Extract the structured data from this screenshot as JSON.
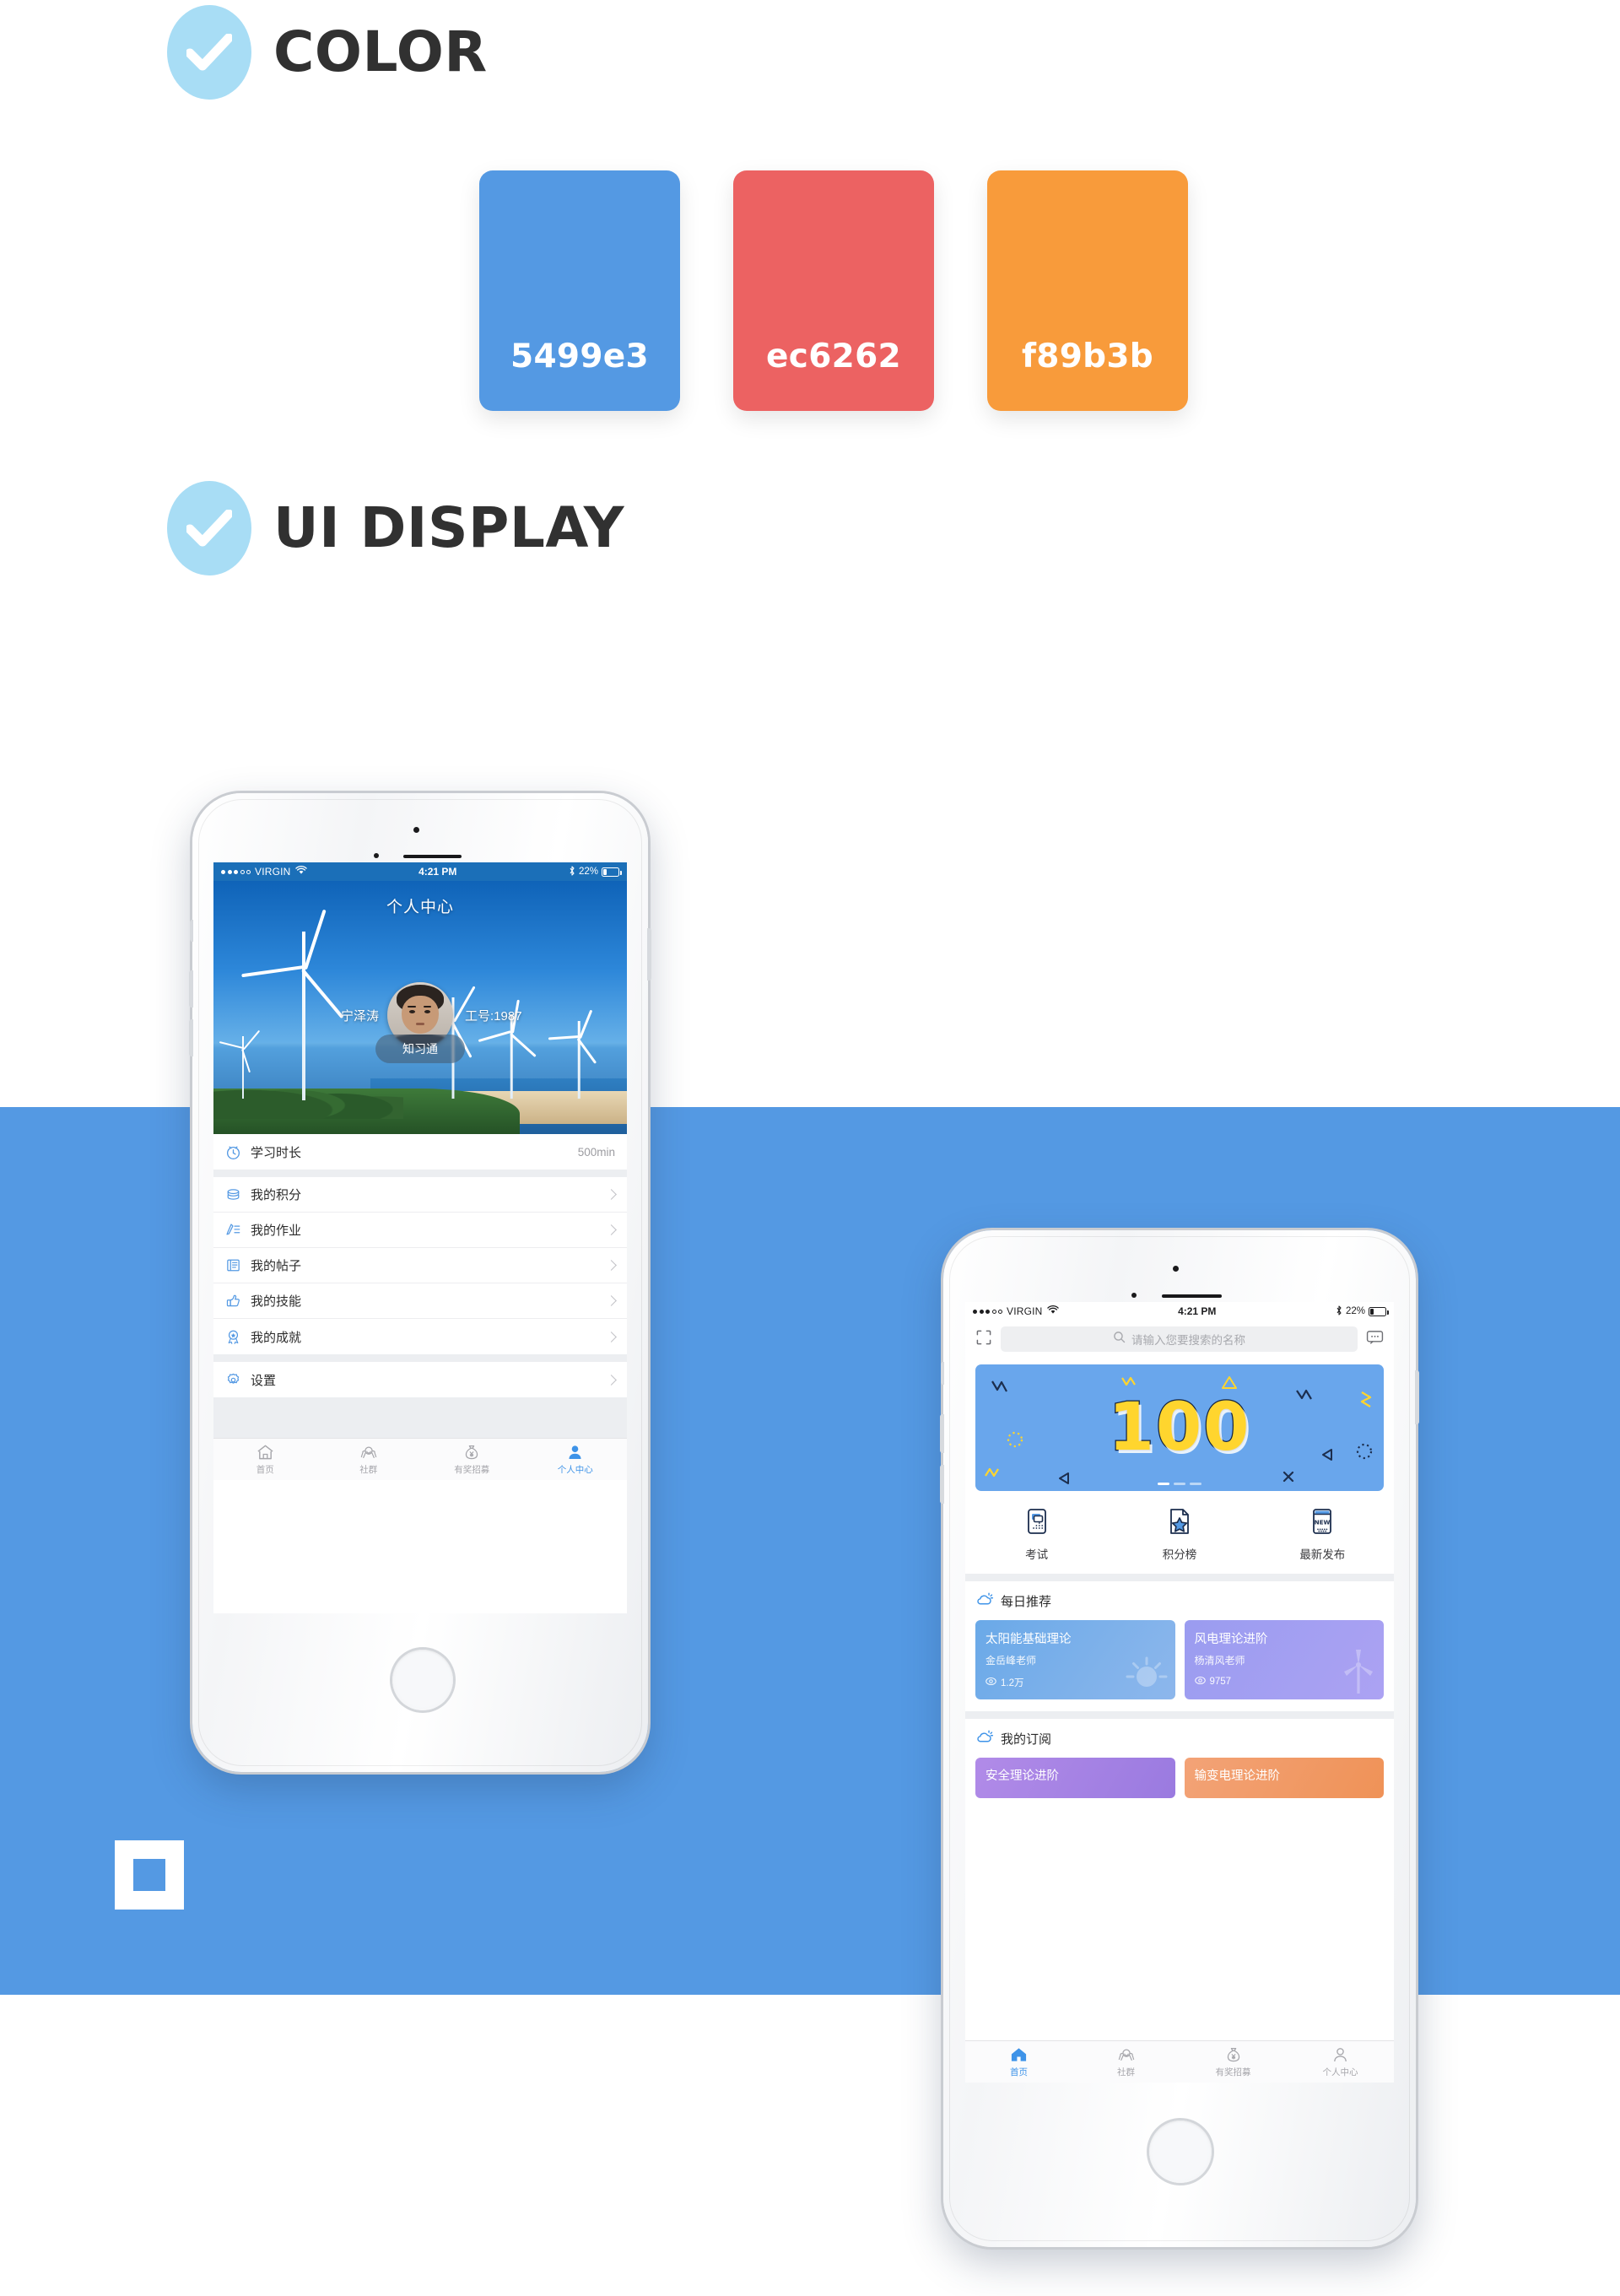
{
  "sections": {
    "color": {
      "title": "COLOR",
      "icon": "check-circle-icon"
    },
    "ui": {
      "title": "UI DISPLAY",
      "icon": "check-circle-icon"
    }
  },
  "palette": [
    {
      "hex": "#5499e3",
      "label": "5499e3"
    },
    {
      "hex": "#ec6262",
      "label": "ec6262"
    },
    {
      "hex": "#f89b3b",
      "label": "f89b3b"
    }
  ],
  "theme": {
    "band_blue": "#5499e3",
    "accent": "#3e93e8",
    "title_dark": "#313131",
    "badge_blue": "#a8ddf5"
  },
  "status_bar": {
    "carrier": "VIRGIN",
    "time": "4:21 PM",
    "battery_pct": "22%",
    "signal_dots_filled": 3,
    "signal_dots_total": 5,
    "wifi_icon": "wifi-icon",
    "bluetooth_icon": "bluetooth-icon"
  },
  "profile_screen": {
    "hero": {
      "title": "个人中心",
      "name": "宁泽涛",
      "employee_id": "工号:1987",
      "badge_label": "知习通",
      "avatar_icon": "avatar"
    },
    "study_row": {
      "icon": "clock-icon",
      "label": "学习时长",
      "value": "500min"
    },
    "menu": [
      {
        "icon": "coins-icon",
        "label": "我的积分",
        "chevron": "chevron-right-icon"
      },
      {
        "icon": "pencil-list-icon",
        "label": "我的作业",
        "chevron": "chevron-right-icon"
      },
      {
        "icon": "post-icon",
        "label": "我的帖子",
        "chevron": "chevron-right-icon"
      },
      {
        "icon": "thumbs-up-icon",
        "label": "我的技能",
        "chevron": "chevron-right-icon"
      },
      {
        "icon": "medal-icon",
        "label": "我的成就",
        "chevron": "chevron-right-icon"
      }
    ],
    "settings_row": {
      "icon": "gear-icon",
      "label": "设置",
      "chevron": "chevron-right-icon"
    },
    "tabs": [
      {
        "icon": "home-icon",
        "label": "首页",
        "active": false
      },
      {
        "icon": "group-icon",
        "label": "社群",
        "active": false
      },
      {
        "icon": "moneybag-icon",
        "label": "有奖招募",
        "active": false
      },
      {
        "icon": "person-icon",
        "label": "个人中心",
        "active": true
      }
    ]
  },
  "home_screen": {
    "search": {
      "placeholder": "请输入您要搜索的名称",
      "scan_icon": "scan-icon",
      "search_icon": "search-icon",
      "message_icon": "message-icon"
    },
    "banner": {
      "number": "100",
      "pages": 3,
      "active_page": 1
    },
    "quick_actions": [
      {
        "icon": "exam-icon",
        "label": "考试"
      },
      {
        "icon": "ranking-icon",
        "label": "积分榜"
      },
      {
        "icon": "new-icon",
        "label": "最新发布"
      }
    ],
    "daily": {
      "icon": "cloud-sun-icon",
      "title": "每日推荐",
      "cards": [
        {
          "title": "太阳能基础理论",
          "teacher": "金岳峰老师",
          "views": "1.2万",
          "views_icon": "eye-icon",
          "art": "sun-icon",
          "color_from": "#6aa9e8",
          "color_to": "#8db7ec"
        },
        {
          "title": "风电理论进阶",
          "teacher": "杨清风老师",
          "views": "9757",
          "views_icon": "eye-icon",
          "art": "turbine-icon",
          "color_from": "#9a9cf0",
          "color_to": "#a9a0f2"
        }
      ]
    },
    "subscriptions": {
      "icon": "cloud-sun-icon",
      "title": "我的订阅",
      "cards": [
        {
          "title": "安全理论进阶",
          "color_from": "#b18be8",
          "color_to": "#9a7ae0"
        },
        {
          "title": "输变电理论进阶",
          "color_from": "#f3a377",
          "color_to": "#ef9257"
        }
      ]
    },
    "tabs": [
      {
        "icon": "home-icon",
        "label": "首页",
        "active": true
      },
      {
        "icon": "group-icon",
        "label": "社群",
        "active": false
      },
      {
        "icon": "moneybag-icon",
        "label": "有奖招募",
        "active": false
      },
      {
        "icon": "person-icon",
        "label": "个人中心",
        "active": false
      }
    ]
  },
  "decor": {
    "square_outline": "white-square-outline"
  }
}
